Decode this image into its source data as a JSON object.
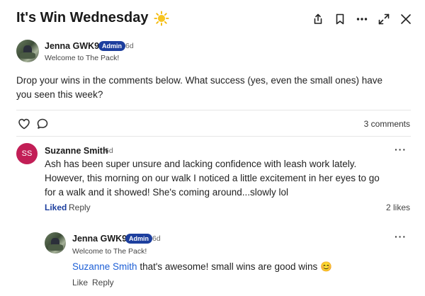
{
  "post": {
    "title": "It's Win Wednesday",
    "author": "Jenna GWK9",
    "badge": "Admin",
    "time": "6d",
    "subtitle": "Welcome to The Pack!",
    "body": "Drop your wins in the comments below. What success (yes, even the small ones) have you seen this week?",
    "comment_count": "3 comments"
  },
  "icons": [
    "share-icon",
    "bookmark-icon",
    "more-icon",
    "expand-icon",
    "close-icon",
    "heart-icon",
    "comment-icon"
  ],
  "comments": [
    {
      "initials": "SS",
      "avatar_color": "#c21e56",
      "author": "Suzanne Smith",
      "time": "6d",
      "text": "Ash has been super unsure and lacking confidence with leash work lately. However, this morning on our walk I noticed a little excitement in her eyes to go for a walk and it showed! She's coming around...slowly lol",
      "liked_label": "Liked",
      "reply_label": "Reply",
      "likes": "2 likes"
    }
  ],
  "reply": {
    "author": "Jenna GWK9",
    "badge": "Admin",
    "time": "6d",
    "subtitle": "Welcome to The Pack!",
    "mention": "Suzanne Smith",
    "text": " that's awesome! small wins are good wins 😊",
    "like_label": "Like",
    "reply_label": "Reply"
  },
  "more_label": "···",
  "accent": "#1d3f9e"
}
